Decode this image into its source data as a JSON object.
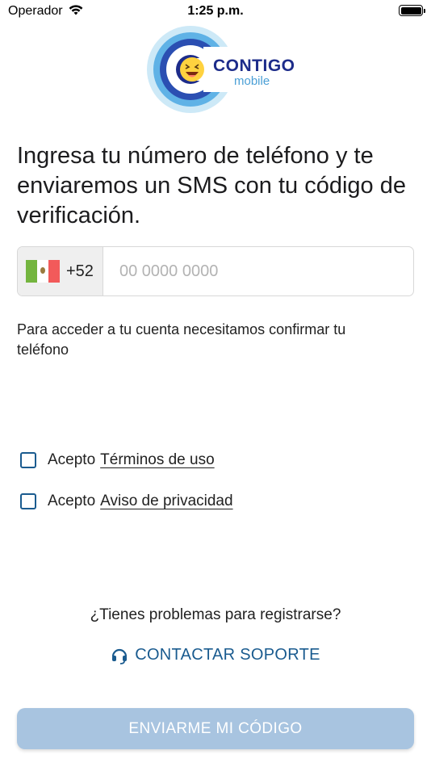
{
  "status_bar": {
    "carrier": "Operador",
    "time": "1:25 p.m."
  },
  "logo": {
    "brand": "CONTIGO",
    "sub": "mobile"
  },
  "headline": "Ingresa tu número de teléfono y te enviaremos un SMS con tu código de verificación.",
  "phone": {
    "country_code": "+52",
    "placeholder": "00 0000 0000",
    "value": ""
  },
  "helper_text": "Para acceder a tu cuenta necesitamos confirmar tu teléfono",
  "terms": {
    "prefix": "Acepto",
    "link": "Términos de uso"
  },
  "privacy": {
    "prefix": "Acepto",
    "link": "Aviso de privacidad"
  },
  "support": {
    "question": "¿Tienes problemas para registrarse?",
    "link": "CONTACTAR SOPORTE"
  },
  "cta_label": "ENVIARME MI CÓDIGO",
  "colors": {
    "primary": "#1a5b8f",
    "cta_disabled": "#a8c4e0",
    "logo_dark": "#1d2c8a",
    "logo_light": "#4a9fd6"
  }
}
